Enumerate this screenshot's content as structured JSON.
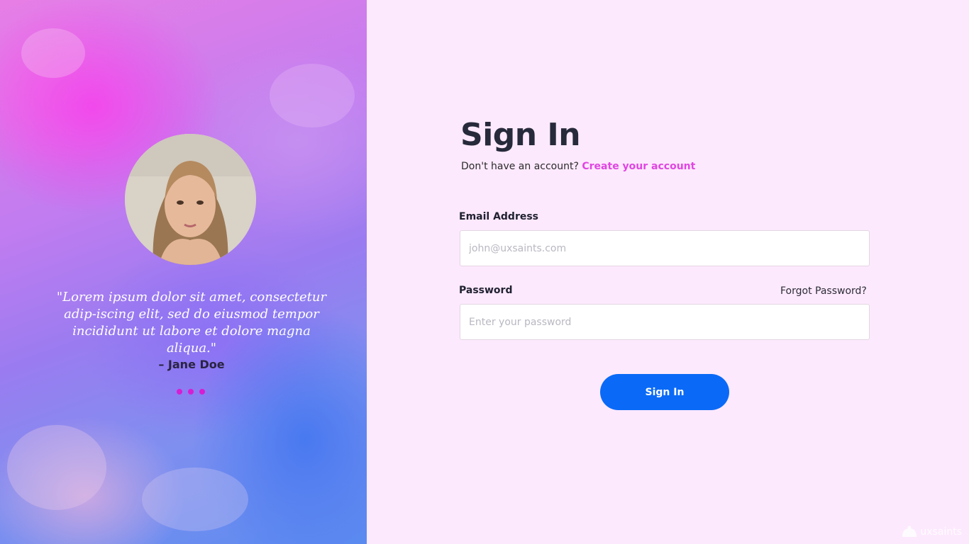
{
  "testimonial": {
    "quote": "\"Lorem ipsum dolor sit amet, consectetur adip-iscing elit, sed do eiusmod tempor incididunt ut labore et dolore magna aliqua.\"",
    "author": "– Jane Doe",
    "dots_count": 3
  },
  "form": {
    "title": "Sign In",
    "subtitle_text": "Don't have an account?",
    "create_account_link": "Create your account",
    "email_label": "Email Address",
    "email_placeholder": "john@uxsaints.com",
    "password_label": "Password",
    "forgot_password": "Forgot Password?",
    "password_placeholder": "Enter your password",
    "submit_label": "Sign In"
  },
  "brand": {
    "name": "uxsaints"
  },
  "colors": {
    "accent_pink": "#e046e2",
    "primary_blue": "#0a6af7",
    "background": "#fde9fd",
    "dot": "#d61ed2"
  }
}
